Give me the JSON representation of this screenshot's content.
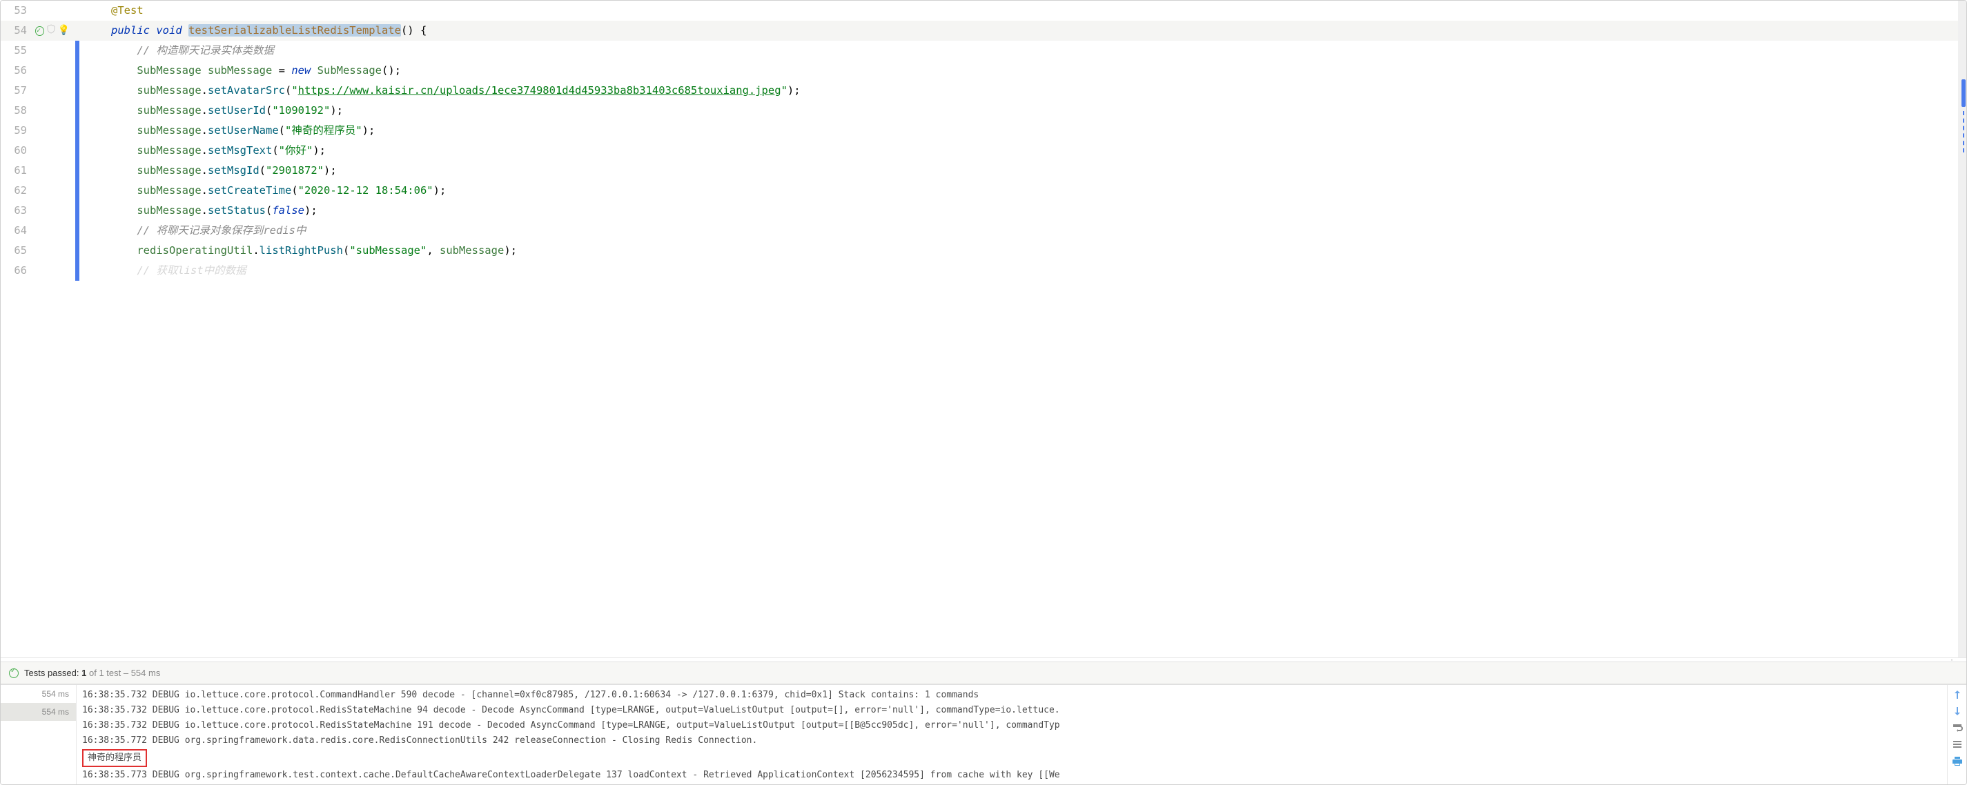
{
  "editor": {
    "lines": [
      {
        "num": "53",
        "tokens": [
          {
            "cls": "tok-annotation",
            "t": "@Test"
          }
        ]
      },
      {
        "num": "54",
        "highlighted": true,
        "hasCheck": true,
        "hasShield": true,
        "hasBulb": true,
        "tokens": [
          {
            "cls": "tok-keyword",
            "t": "public"
          },
          {
            "t": " "
          },
          {
            "cls": "tok-keyword",
            "t": "void"
          },
          {
            "t": " "
          },
          {
            "cls": "tok-method selection-bg",
            "t": "testSerializableListRedisTemplate"
          },
          {
            "cls": "tok-punct",
            "t": "() {"
          }
        ]
      },
      {
        "num": "55",
        "indent": "    ",
        "tokens": [
          {
            "cls": "tok-comment",
            "t": "// 构造聊天记录实体类数据"
          }
        ]
      },
      {
        "num": "56",
        "indent": "    ",
        "tokens": [
          {
            "cls": "tok-type",
            "t": "SubMessage"
          },
          {
            "t": " "
          },
          {
            "cls": "tok-identifier",
            "t": "subMessage"
          },
          {
            "t": " = "
          },
          {
            "cls": "tok-keyword",
            "t": "new"
          },
          {
            "t": " "
          },
          {
            "cls": "tok-type",
            "t": "SubMessage"
          },
          {
            "cls": "tok-punct",
            "t": "();"
          }
        ]
      },
      {
        "num": "57",
        "indent": "    ",
        "tokens": [
          {
            "cls": "tok-identifier",
            "t": "subMessage"
          },
          {
            "cls": "tok-punct",
            "t": "."
          },
          {
            "cls": "tok-method-call",
            "t": "setAvatarSrc"
          },
          {
            "cls": "tok-punct",
            "t": "("
          },
          {
            "cls": "tok-string",
            "t": "\""
          },
          {
            "cls": "tok-string-link",
            "t": "https://www.kaisir.cn/uploads/1ece3749801d4d45933ba8b31403c685touxiang.jpeg"
          },
          {
            "cls": "tok-string",
            "t": "\""
          },
          {
            "cls": "tok-punct",
            "t": ");"
          }
        ]
      },
      {
        "num": "58",
        "indent": "    ",
        "tokens": [
          {
            "cls": "tok-identifier",
            "t": "subMessage"
          },
          {
            "cls": "tok-punct",
            "t": "."
          },
          {
            "cls": "tok-method-call",
            "t": "setUserId"
          },
          {
            "cls": "tok-punct",
            "t": "("
          },
          {
            "cls": "tok-string",
            "t": "\"1090192\""
          },
          {
            "cls": "tok-punct",
            "t": ");"
          }
        ]
      },
      {
        "num": "59",
        "indent": "    ",
        "tokens": [
          {
            "cls": "tok-identifier",
            "t": "subMessage"
          },
          {
            "cls": "tok-punct",
            "t": "."
          },
          {
            "cls": "tok-method-call",
            "t": "setUserName"
          },
          {
            "cls": "tok-punct",
            "t": "("
          },
          {
            "cls": "tok-string",
            "t": "\"神奇的程序员\""
          },
          {
            "cls": "tok-punct",
            "t": ");"
          }
        ]
      },
      {
        "num": "60",
        "indent": "    ",
        "tokens": [
          {
            "cls": "tok-identifier",
            "t": "subMessage"
          },
          {
            "cls": "tok-punct",
            "t": "."
          },
          {
            "cls": "tok-method-call",
            "t": "setMsgText"
          },
          {
            "cls": "tok-punct",
            "t": "("
          },
          {
            "cls": "tok-string",
            "t": "\"你好\""
          },
          {
            "cls": "tok-punct",
            "t": ");"
          }
        ]
      },
      {
        "num": "61",
        "indent": "    ",
        "tokens": [
          {
            "cls": "tok-identifier",
            "t": "subMessage"
          },
          {
            "cls": "tok-punct",
            "t": "."
          },
          {
            "cls": "tok-method-call",
            "t": "setMsgId"
          },
          {
            "cls": "tok-punct",
            "t": "("
          },
          {
            "cls": "tok-string",
            "t": "\"2901872\""
          },
          {
            "cls": "tok-punct",
            "t": ");"
          }
        ]
      },
      {
        "num": "62",
        "indent": "    ",
        "tokens": [
          {
            "cls": "tok-identifier",
            "t": "subMessage"
          },
          {
            "cls": "tok-punct",
            "t": "."
          },
          {
            "cls": "tok-method-call",
            "t": "setCreateTime"
          },
          {
            "cls": "tok-punct",
            "t": "("
          },
          {
            "cls": "tok-string",
            "t": "\"2020-12-12 18:54:06\""
          },
          {
            "cls": "tok-punct",
            "t": ");"
          }
        ]
      },
      {
        "num": "63",
        "indent": "    ",
        "tokens": [
          {
            "cls": "tok-identifier",
            "t": "subMessage"
          },
          {
            "cls": "tok-punct",
            "t": "."
          },
          {
            "cls": "tok-method-call",
            "t": "setStatus"
          },
          {
            "cls": "tok-punct",
            "t": "("
          },
          {
            "cls": "tok-bool",
            "t": "false"
          },
          {
            "cls": "tok-punct",
            "t": ");"
          }
        ]
      },
      {
        "num": "64",
        "indent": "    ",
        "tokens": [
          {
            "cls": "tok-comment",
            "t": "// 将聊天记录对象保存到redis中"
          }
        ]
      },
      {
        "num": "65",
        "indent": "    ",
        "tokens": [
          {
            "cls": "tok-identifier",
            "t": "redisOperatingUtil"
          },
          {
            "cls": "tok-punct",
            "t": "."
          },
          {
            "cls": "tok-method-call",
            "t": "listRightPush"
          },
          {
            "cls": "tok-punct",
            "t": "("
          },
          {
            "cls": "tok-string",
            "t": "\"subMessage\""
          },
          {
            "cls": "tok-punct",
            "t": ", "
          },
          {
            "cls": "tok-identifier",
            "t": "subMessage"
          },
          {
            "cls": "tok-punct",
            "t": ");"
          }
        ]
      },
      {
        "num": "66",
        "indent": "    ",
        "partial": true,
        "tokens": [
          {
            "cls": "tok-comment",
            "t": "// 获取list中的数据"
          }
        ]
      }
    ]
  },
  "testStatus": {
    "label": "Tests passed:",
    "count": "1",
    "of": "of 1 test",
    "time": "– 554 ms"
  },
  "consoleSidebar": {
    "items": [
      {
        "time": "554 ms",
        "selected": false
      },
      {
        "time": "554 ms",
        "selected": true
      }
    ]
  },
  "console": {
    "lines": [
      "16:38:35.732 DEBUG io.lettuce.core.protocol.CommandHandler 590 decode - [channel=0xf0c87985, /127.0.0.1:60634 -> /127.0.0.1:6379, chid=0x1] Stack contains: 1 commands",
      "16:38:35.732 DEBUG io.lettuce.core.protocol.RedisStateMachine 94 decode - Decode AsyncCommand [type=LRANGE, output=ValueListOutput [output=[], error='null'], commandType=io.lettuce.",
      "16:38:35.732 DEBUG io.lettuce.core.protocol.RedisStateMachine 191 decode - Decoded AsyncCommand [type=LRANGE, output=ValueListOutput [output=[[B@5cc905dc], error='null'], commandTyp",
      "16:38:35.772 DEBUG org.springframework.data.redis.core.RedisConnectionUtils 242 releaseConnection - Closing Redis Connection."
    ],
    "highlightedLine": "神奇的程序员",
    "lastLine": "16:38:35.773 DEBUG org.springframework.test.context.cache.DefaultCacheAwareContextLoaderDelegate 137 loadContext - Retrieved ApplicationContext [2056234595] from cache with key [[We"
  }
}
